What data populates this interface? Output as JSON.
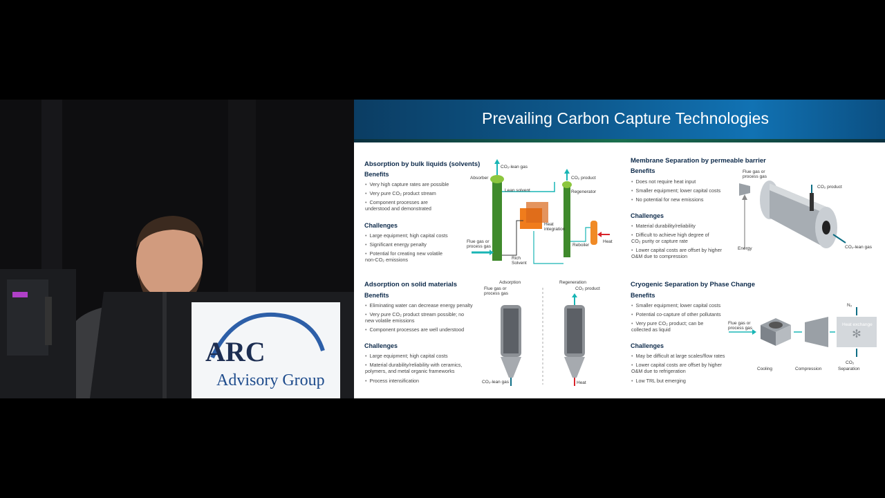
{
  "slide": {
    "title": "Prevailing Carbon Capture Technologies",
    "sections": {
      "absorption": {
        "title": "Absorption by bulk liquids (solvents)",
        "benefits_label": "Benefits",
        "benefits": [
          "Very high capture rates are possible",
          "Very pure CO₂ product stream",
          "Component processes are understood and demonstrated"
        ],
        "challenges_label": "Challenges",
        "challenges": [
          "Large equipment; high capital costs",
          "Significant energy penalty",
          "Potential for creating new volatile non-CO₂ emissions"
        ],
        "diagram": {
          "co2_lean_gas": "CO₂-lean gas",
          "absorber": "Absorber",
          "lean_solvent": "Lean solvent",
          "co2_product": "CO₂ product",
          "regenerator": "Regenerator",
          "heat_integration": "Heat integration",
          "reboiler": "Reboiler",
          "heat": "Heat",
          "flue_gas": "Flue gas or process gas",
          "rich_solvent": "Rich Solvent"
        }
      },
      "solid": {
        "title": "Adsorption on solid materials",
        "benefits_label": "Benefits",
        "benefits": [
          "Eliminating water can decrease energy penalty",
          "Very pure CO₂ product stream possible; no new volatile emissions",
          "Component processes are well understood"
        ],
        "challenges_label": "Challenges",
        "challenges": [
          "Large equipment; high capital costs",
          "Material durability/reliability with ceramics, polymers, and metal organic frameworks",
          "Process intensification"
        ],
        "diagram": {
          "adsorption": "Adsorption",
          "regeneration": "Regeneration",
          "flue_gas": "Flue gas or process gas",
          "co2_product": "CO₂ product",
          "co2_lean_gas": "CO₂-lean gas",
          "heat": "Heat"
        }
      },
      "membrane": {
        "title": "Membrane Separation by permeable barrier",
        "benefits_label": "Benefits",
        "benefits": [
          "Does not require heat input",
          "Smaller equipment; lower capital costs",
          "No potential for new emissions"
        ],
        "challenges_label": "Challenges",
        "challenges": [
          "Material durability/reliability",
          "Difficult to achieve high degree of CO₂ purity or capture rate",
          "Lower capital costs are offset by higher O&M due to compression"
        ],
        "diagram": {
          "flue_gas": "Flue gas or process gas",
          "co2_product": "CO₂ product",
          "energy": "Energy",
          "co2_lean_gas": "CO₂-lean gas"
        }
      },
      "cryogenic": {
        "title": "Cryogenic Separation by Phase Change",
        "benefits_label": "Benefits",
        "benefits": [
          "Smaller equipment; lower capital costs",
          "Potential co-capture of other pollutants",
          "Very pure CO₂ product; can be collected as liquid"
        ],
        "challenges_label": "Challenges",
        "challenges": [
          "May be difficult at large scales/flow rates",
          "Lower capital costs are offset by higher O&M due to refrigeration",
          "Low TRL but emerging"
        ],
        "diagram": {
          "flue_gas": "Flue gas or process gas",
          "n2": "N₂",
          "heat_exchange": "Heat exchange",
          "co2": "CO₂",
          "cooling": "Cooling",
          "compression": "Compression",
          "separation": "Separation"
        }
      }
    }
  },
  "podium": {
    "logo_line1": "ARC",
    "logo_line2": "Advisory Group"
  },
  "colors": {
    "header_blue": "#0e5a8f",
    "column_green": "#3f8a2c",
    "arrow_teal": "#18b5b5",
    "heat_red": "#d8232a",
    "hx_orange": "#f07c1c"
  }
}
